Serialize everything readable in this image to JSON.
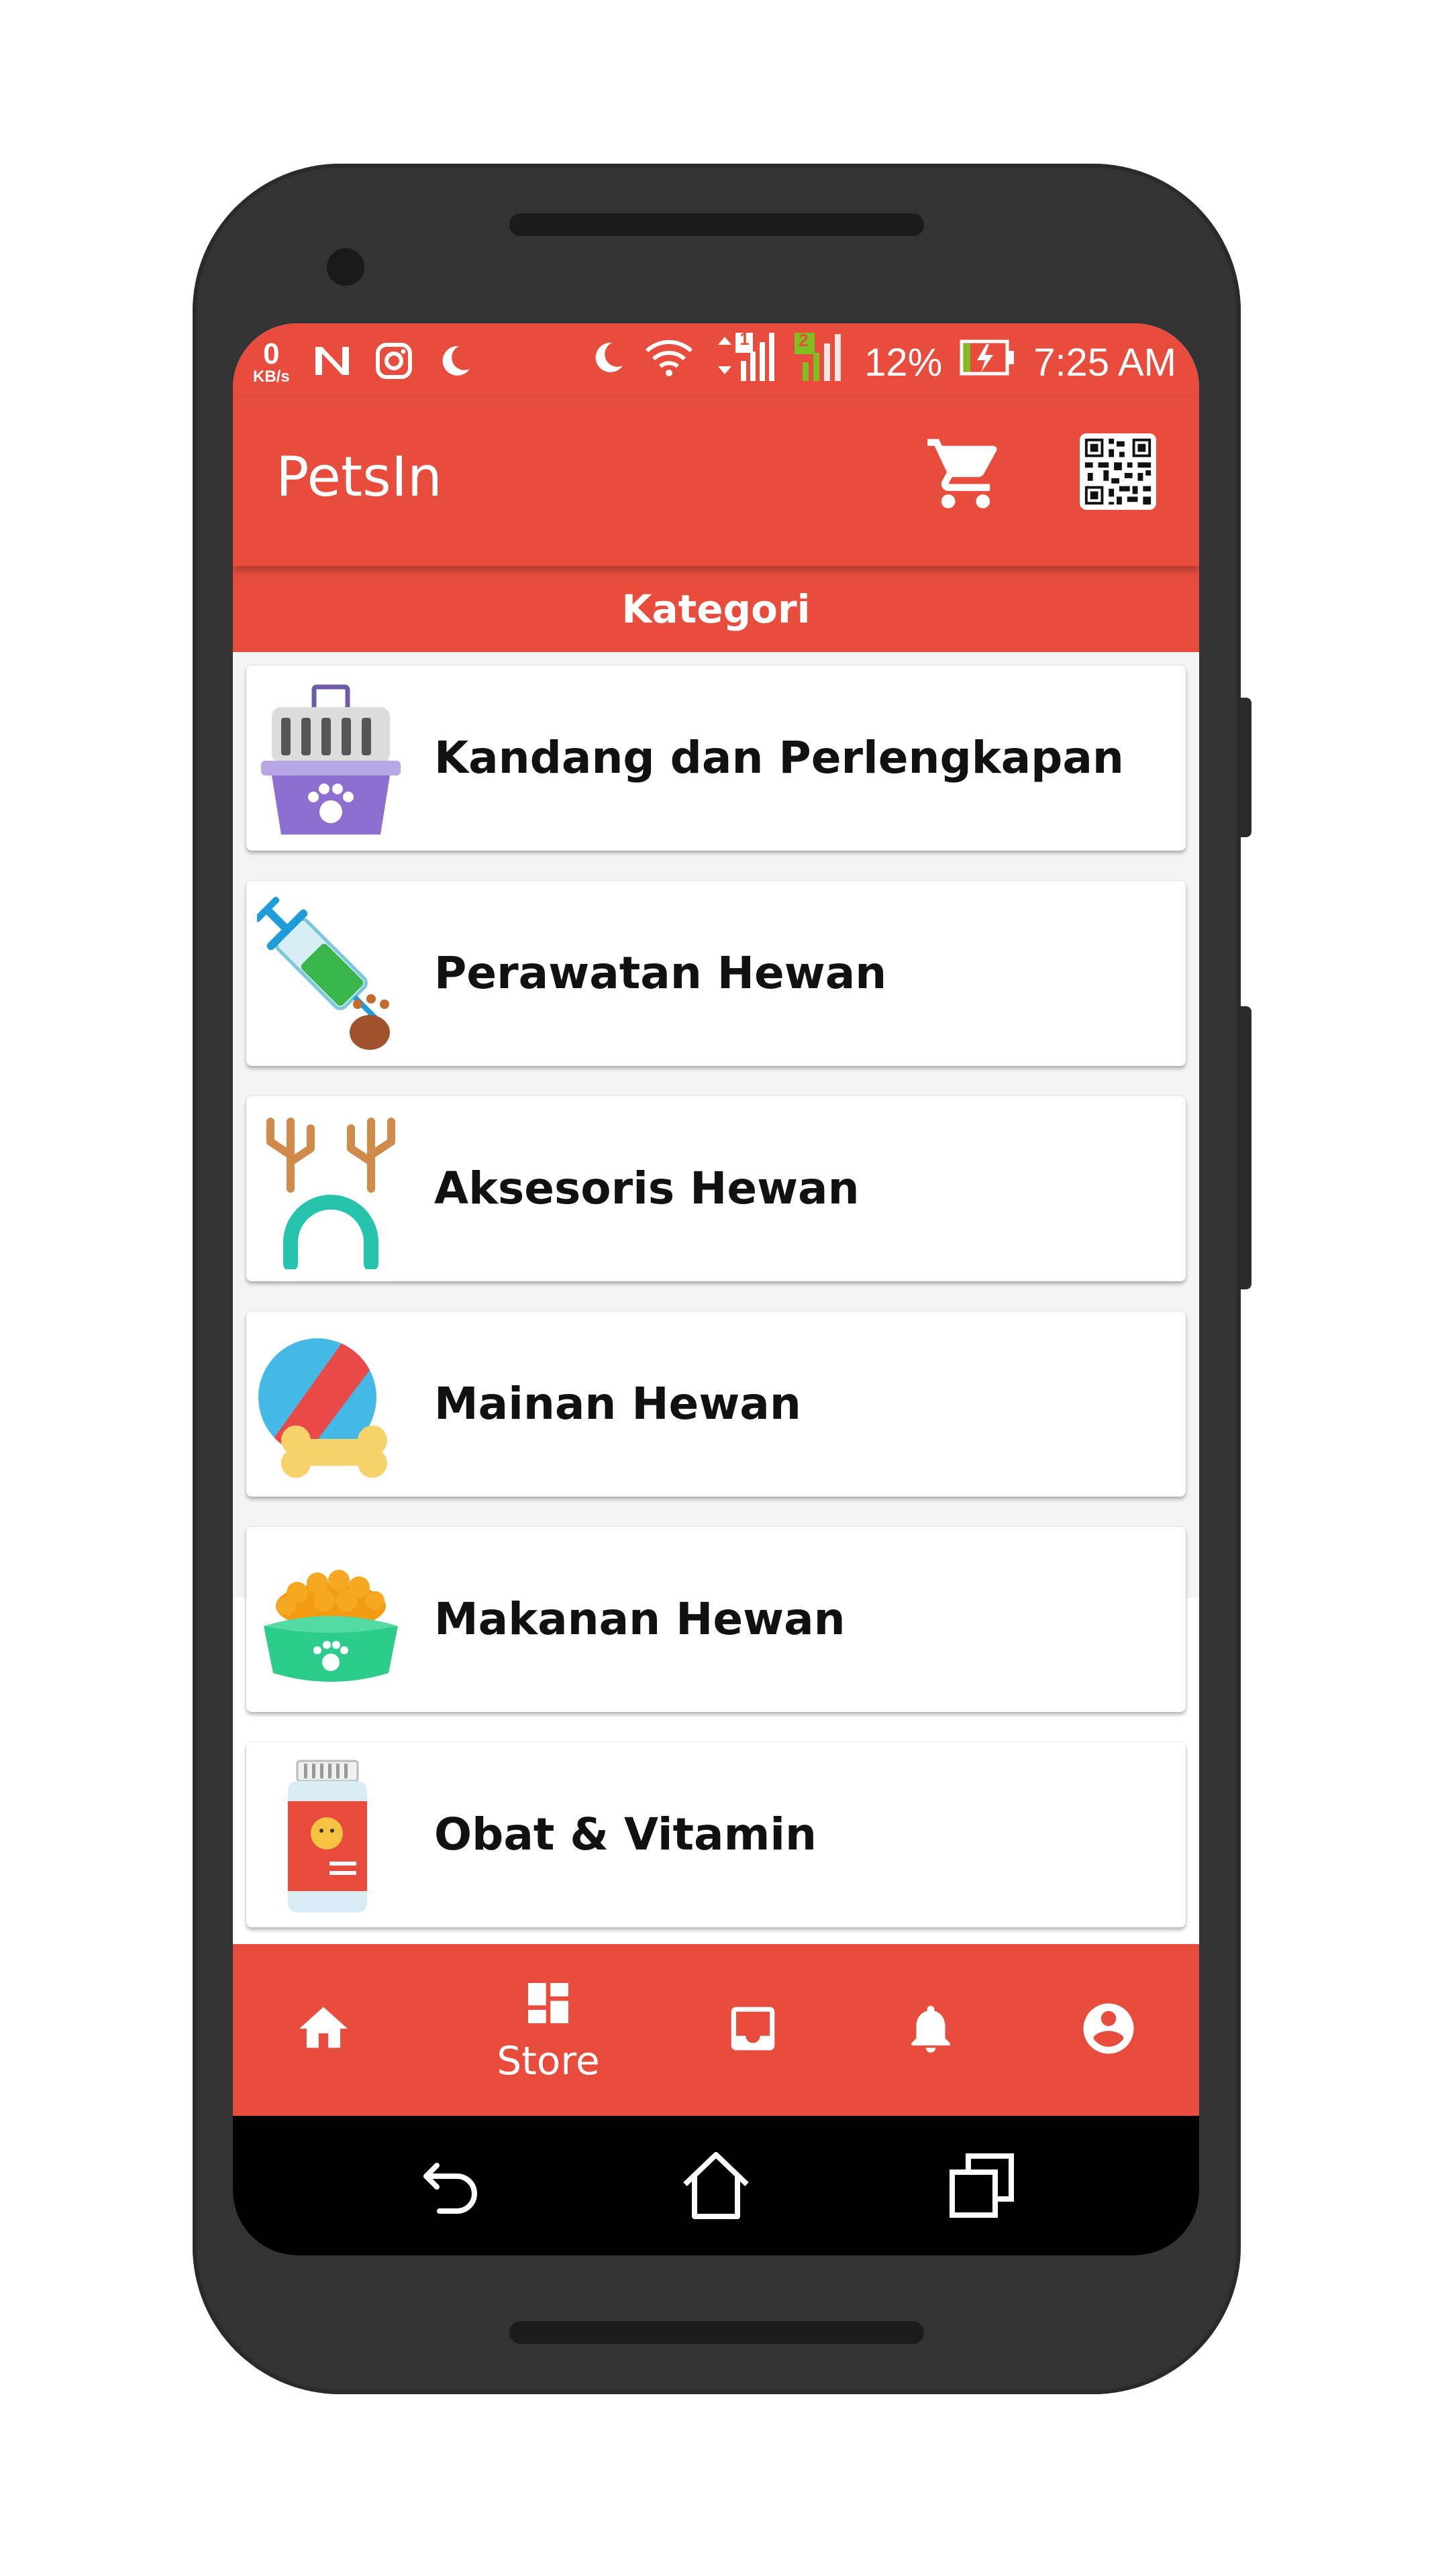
{
  "status_bar": {
    "network_speed_value": "0",
    "network_speed_unit": "KB/s",
    "sim_badge": "1",
    "sim2_badge": "2",
    "battery_percent": "12%",
    "time": "7:25 AM",
    "icons": [
      "notification-n-icon",
      "instagram-icon",
      "moon-icon",
      "moon-icon",
      "wifi-icon",
      "signal-icon",
      "signal-icon",
      "battery-charging-icon"
    ]
  },
  "app_bar": {
    "title": "PetsIn",
    "actions": [
      "cart-icon",
      "qr-code-icon"
    ]
  },
  "section": {
    "title": "Kategori"
  },
  "categories": [
    {
      "label": "Kandang dan Perlengkapan",
      "icon": "pet-carrier-icon"
    },
    {
      "label": "Perawatan Hewan",
      "icon": "syringe-icon"
    },
    {
      "label": "Aksesoris Hewan",
      "icon": "antler-headband-icon"
    },
    {
      "label": "Mainan Hewan",
      "icon": "ball-bone-icon"
    },
    {
      "label": "Makanan Hewan",
      "icon": "food-bowl-icon"
    },
    {
      "label": "Obat & Vitamin",
      "icon": "medicine-bottle-icon"
    }
  ],
  "bottom_nav": {
    "items": [
      {
        "icon": "home-icon",
        "label": ""
      },
      {
        "icon": "store-dashboard-icon",
        "label": "Store"
      },
      {
        "icon": "inbox-icon",
        "label": ""
      },
      {
        "icon": "bell-icon",
        "label": ""
      },
      {
        "icon": "account-icon",
        "label": ""
      }
    ],
    "active": "Store"
  },
  "system_nav": [
    "back-icon",
    "home-outline-icon",
    "recents-icon"
  ],
  "colors": {
    "primary": "#e74c3c",
    "phone_body": "#333334",
    "card_text": "#111111"
  }
}
